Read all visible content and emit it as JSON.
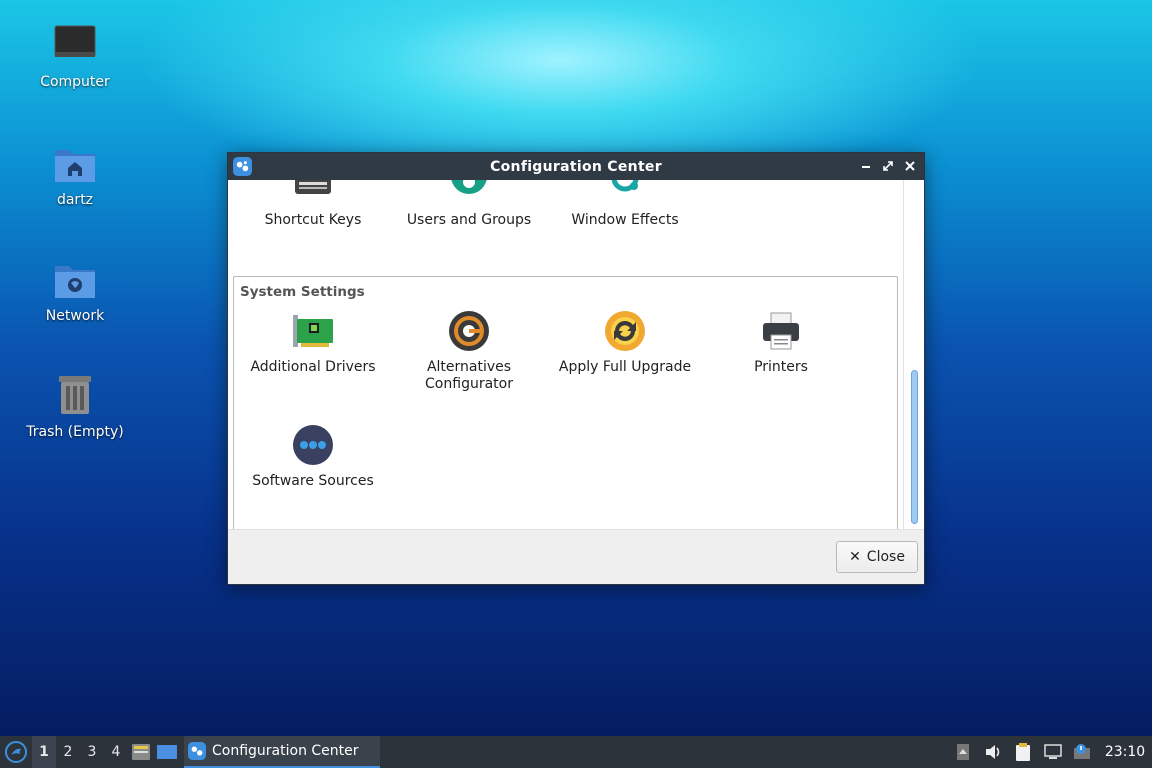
{
  "desktop": {
    "icons": [
      {
        "label": "Computer"
      },
      {
        "label": "dartz"
      },
      {
        "label": "Network"
      },
      {
        "label": "Trash (Empty)"
      }
    ]
  },
  "window": {
    "title": "Configuration Center",
    "top_items": [
      {
        "label": "Shortcut Keys",
        "icon": "keyboard-icon"
      },
      {
        "label": "Users and Groups",
        "icon": "users-icon"
      },
      {
        "label": "Window Effects",
        "icon": "window-effects-icon"
      }
    ],
    "group_title": "System Settings",
    "system_items": [
      {
        "label": "Additional Drivers",
        "icon": "hardware-card-icon"
      },
      {
        "label": "Alternatives Configurator",
        "icon": "alternatives-icon"
      },
      {
        "label": "Apply Full Upgrade",
        "icon": "upgrade-icon"
      },
      {
        "label": "Printers",
        "icon": "printer-icon"
      },
      {
        "label": "Software Sources",
        "icon": "software-sources-icon"
      }
    ],
    "close_label": "Close"
  },
  "taskbar": {
    "workspaces": [
      "1",
      "2",
      "3",
      "4"
    ],
    "active_workspace": "1",
    "task_label": "Configuration Center",
    "clock": "23:10"
  },
  "colors": {
    "accent": "#3d8fe0",
    "titlebar": "#2f3a45",
    "taskbar": "#2d333a"
  }
}
